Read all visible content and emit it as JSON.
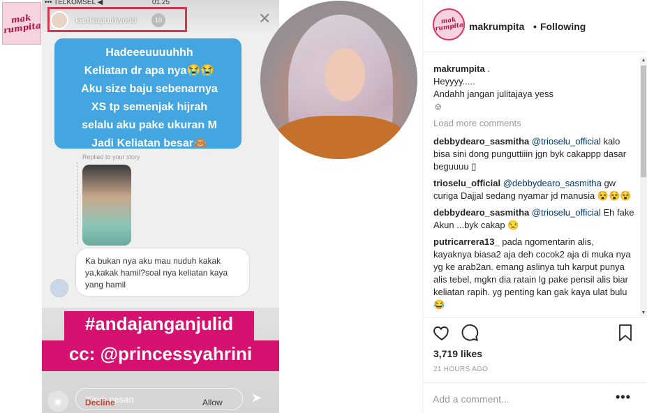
{
  "media": {
    "logo_text": "mak\nrumpita",
    "story": {
      "carrier": "••• TELKOMSEL ◀",
      "time": "01.25",
      "username": "kartikaputriworld",
      "count": "10",
      "close_glyph": "✕",
      "dm_text": "Hadeeeuuuuhhh\nKeliatan dr apa nya😭😭\nAku size baju sebenarnya\nXS tp semenjak hijrah\nselalu aku pake ukuran M\nJadi Keliatan besar🙈",
      "replied_label": "Replied to your story",
      "reply_text": "Ka bukan nya aku mau nuduh kakak\nya,kakak hamil?soal nya keliatan kaya\nyang hamil",
      "hashtag": "#andajanganjulid",
      "cc": "cc: @princessyahrini",
      "message_placeholder": "Kirim pesan",
      "decline_label": "Decline",
      "allow_label": "Allow"
    }
  },
  "panel": {
    "header": {
      "username": "makrumpita",
      "separator": "•",
      "follow_status": "Following"
    },
    "caption": {
      "username": "makrumpita",
      "suffix": " .",
      "lines": [
        "Heyyyy.....",
        "Andahh jangan julitajaya yess",
        "☺"
      ]
    },
    "load_more": "Load more comments",
    "comments": [
      {
        "user": "debbydearo_sasmitha",
        "mention": "@trioselu_official",
        "text": "kalo bisa sini dong punguttiiin jgn byk cakappp dasar beguuuu ▯"
      },
      {
        "user": "trioselu_official",
        "mention": "@debbydearo_sasmitha",
        "text": "gw curiga Dajjal sedang nyamar jd manusia 😵😵😵"
      },
      {
        "user": "debbydearo_sasmitha",
        "mention": "@trioselu_official",
        "text": "Eh fake Akun ...byk cakap 😒"
      },
      {
        "user": "putricarrera13_",
        "mention": "",
        "text": "pada ngomentarin alis, kayaknya biasa2 aja deh cocok2 aja di muka nya yg ke arab2an. emang aslinya tuh karput punya alis tebel, mgkn dia ratain lg pake pensil alis biar keliatan rapih. yg penting kan gak kaya ulat bulu 😂"
      }
    ],
    "likes": "3,719 likes",
    "time_ago": "21 HOURS AGO",
    "comment_placeholder": "Add a comment...",
    "more_glyph": "•••"
  }
}
